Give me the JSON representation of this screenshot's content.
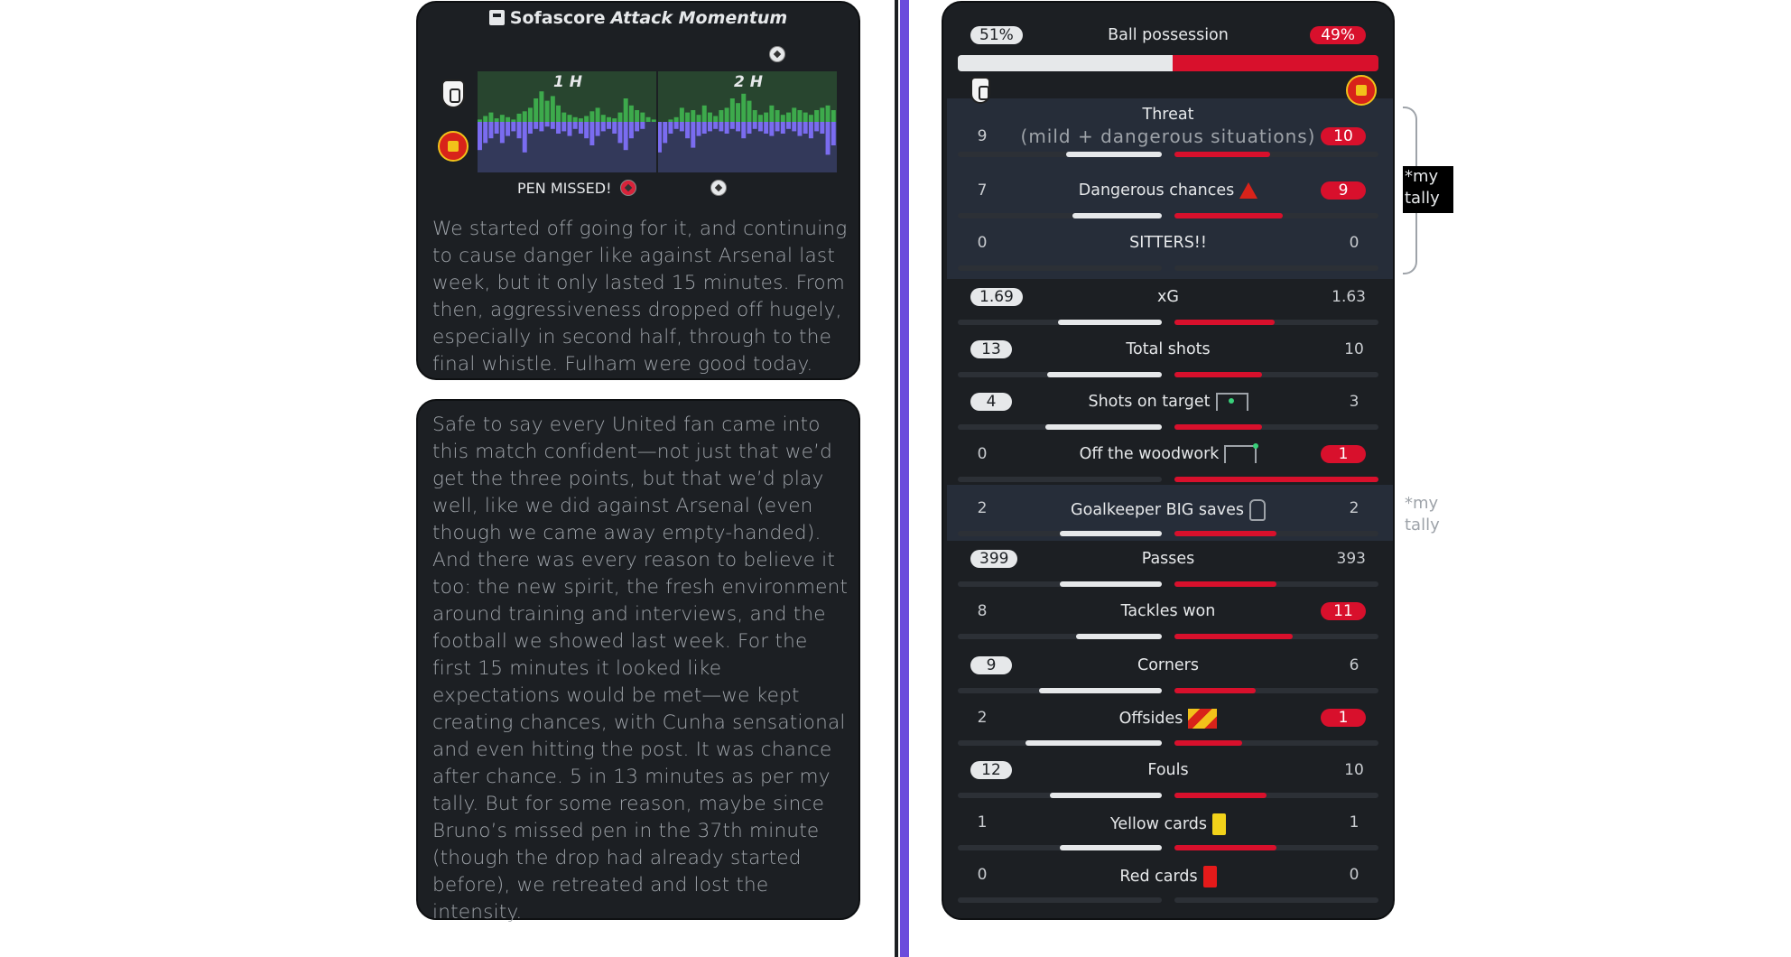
{
  "momentum": {
    "brand": "Sofascore",
    "title": "Attack Momentum",
    "half1": "1 H",
    "half2": "2 H",
    "pen_missed": "PEN MISSED!",
    "home_values": [
      2,
      5,
      8,
      3,
      6,
      4,
      2,
      7,
      9,
      12,
      20,
      26,
      18,
      22,
      14,
      8,
      6,
      4,
      3,
      5,
      9,
      12,
      6,
      4,
      3,
      8,
      20,
      14,
      10,
      8,
      4,
      2,
      0,
      0,
      2,
      4,
      12,
      8,
      10,
      6,
      14,
      8,
      5,
      10,
      12,
      20,
      16,
      24,
      18,
      10,
      6,
      8,
      14,
      10,
      6,
      8,
      12,
      10,
      8,
      6,
      10,
      12,
      14,
      10
    ],
    "away_values": [
      24,
      18,
      14,
      10,
      18,
      12,
      8,
      14,
      26,
      10,
      6,
      8,
      4,
      6,
      10,
      8,
      12,
      6,
      10,
      14,
      20,
      12,
      8,
      6,
      10,
      18,
      24,
      14,
      8,
      6,
      0,
      0,
      26,
      18,
      10,
      6,
      8,
      14,
      22,
      12,
      10,
      8,
      6,
      8,
      10,
      6,
      8,
      14,
      10,
      6,
      8,
      10,
      12,
      8,
      10,
      6,
      8,
      12,
      10,
      14,
      8,
      10,
      28,
      20
    ]
  },
  "essay": {
    "p1": "We started off going for it, and continuing to cause danger like against Arsenal last week, but it only lasted 15 minutes. From then, aggressiveness dropped off hugely, especially in second half, through to the final whistle. Fulham were good today.",
    "p2": "Safe to say every United fan came into this match confident—not just that we’d get the three points, but that we’d play well, like we did against Arsenal (even though we came away empty-handed). And there was every reason to believe it too: the new spirit, the fresh environment around training and interviews, and the football we showed last week. For the first 15 minutes it looked like expectations would be met—we kept creating chances, with Cunha sensational and even hitting the post. It was chance after chance. 5 in 13 minutes as per my tally. But for some reason, maybe since Bruno’s missed pen in the 37th minute (though the drop had already started before), we retreated and lost the intensity."
  },
  "possession": {
    "label": "Ball possession",
    "home": "51%",
    "away": "49%",
    "home_pct": 51,
    "away_pct": 49
  },
  "stats": [
    {
      "label": "Threat",
      "sub": "(mild + dangerous situations)",
      "home": "9",
      "away": "10",
      "hl": "away",
      "hfrac": 0.47,
      "afrac": 0.47
    },
    {
      "label": "Dangerous chances",
      "home": "7",
      "away": "9",
      "hl": "away",
      "icon": "warning-icon",
      "hfrac": 0.44,
      "afrac": 0.53
    },
    {
      "label": "SITTERS!!",
      "home": "0",
      "away": "0",
      "hl": "none",
      "hfrac": 0,
      "afrac": 0
    },
    {
      "label": "xG",
      "home": "1.69",
      "away": "1.63",
      "hl": "home",
      "hfrac": 0.51,
      "afrac": 0.49
    },
    {
      "label": "Total shots",
      "home": "13",
      "away": "10",
      "hl": "home",
      "hfrac": 0.56,
      "afrac": 0.43
    },
    {
      "label": "Shots on target",
      "home": "4",
      "away": "3",
      "hl": "home",
      "icon": "goal-icon",
      "hfrac": 0.57,
      "afrac": 0.43
    },
    {
      "label": "Off the woodwork",
      "home": "0",
      "away": "1",
      "hl": "away",
      "icon": "post-icon",
      "hfrac": 0,
      "afrac": 1
    },
    {
      "label": "Goalkeeper BIG saves",
      "home": "2",
      "away": "2",
      "hl": "none",
      "icon": "glove-icon",
      "hfrac": 0.5,
      "afrac": 0.5
    },
    {
      "label": "Passes",
      "home": "399",
      "away": "393",
      "hl": "home",
      "hfrac": 0.5,
      "afrac": 0.5
    },
    {
      "label": "Tackles won",
      "home": "8",
      "away": "11",
      "hl": "away",
      "hfrac": 0.42,
      "afrac": 0.58
    },
    {
      "label": "Corners",
      "home": "9",
      "away": "6",
      "hl": "home",
      "hfrac": 0.6,
      "afrac": 0.4
    },
    {
      "label": "Offsides",
      "home": "2",
      "away": "1",
      "hl": "away",
      "icon": "flag-icon",
      "hfrac": 0.67,
      "afrac": 0.33
    },
    {
      "label": "Fouls",
      "home": "12",
      "away": "10",
      "hl": "home",
      "hfrac": 0.55,
      "afrac": 0.45
    },
    {
      "label": "Yellow cards",
      "home": "1",
      "away": "1",
      "hl": "none",
      "icon": "yellow-card-icon",
      "hfrac": 0.5,
      "afrac": 0.5
    },
    {
      "label": "Red cards",
      "home": "0",
      "away": "0",
      "hl": "none",
      "icon": "red-card-icon",
      "hfrac": 0,
      "afrac": 0
    }
  ],
  "tally": {
    "text1": "*my tally",
    "text2": "*my tally"
  },
  "colors": {
    "home_fill": "#e6e8ea",
    "away_fill": "#d8102c",
    "momentum_home": "#3daa4c",
    "momentum_away": "#7a6cf0",
    "divider": "#6b4cdc"
  }
}
